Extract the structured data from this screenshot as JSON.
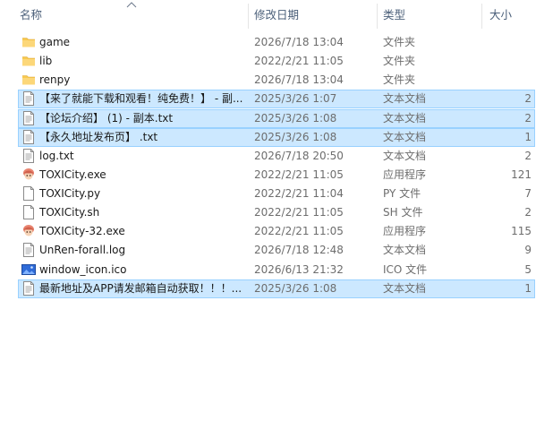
{
  "columns": {
    "name": "名称",
    "date": "修改日期",
    "type": "类型",
    "size": "大小"
  },
  "accent": {
    "selection_bg": "#cce8ff",
    "selection_border": "#99d1ff",
    "folder": "#f8c94f"
  },
  "rows": [
    {
      "name": "game",
      "date": "2026/7/18 13:04",
      "type": "文件夹",
      "size": "",
      "icon": "folder-icon",
      "selected": false
    },
    {
      "name": "lib",
      "date": "2022/2/21 11:05",
      "type": "文件夹",
      "size": "",
      "icon": "folder-icon",
      "selected": false
    },
    {
      "name": "renpy",
      "date": "2026/7/18 13:04",
      "type": "文件夹",
      "size": "",
      "icon": "folder-icon",
      "selected": false
    },
    {
      "name": "【来了就能下载和观看！纯免费！】 - 副...",
      "date": "2025/3/26 1:07",
      "type": "文本文档",
      "size": "2",
      "icon": "text-file-icon",
      "selected": true
    },
    {
      "name": "【论坛介绍】 (1) - 副本.txt",
      "date": "2025/3/26 1:08",
      "type": "文本文档",
      "size": "2",
      "icon": "text-file-icon",
      "selected": true
    },
    {
      "name": "【永久地址发布页】 .txt",
      "date": "2025/3/26 1:08",
      "type": "文本文档",
      "size": "1",
      "icon": "text-file-icon",
      "selected": true
    },
    {
      "name": "log.txt",
      "date": "2026/7/18 20:50",
      "type": "文本文档",
      "size": "2",
      "icon": "text-file-icon",
      "selected": false
    },
    {
      "name": "TOXICity.exe",
      "date": "2022/2/21 11:05",
      "type": "应用程序",
      "size": "121",
      "icon": "app-icon",
      "selected": false
    },
    {
      "name": "TOXICity.py",
      "date": "2022/2/21 11:04",
      "type": "PY 文件",
      "size": "7",
      "icon": "blank-file-icon",
      "selected": false
    },
    {
      "name": "TOXICity.sh",
      "date": "2022/2/21 11:05",
      "type": "SH 文件",
      "size": "2",
      "icon": "blank-file-icon",
      "selected": false
    },
    {
      "name": "TOXICity-32.exe",
      "date": "2022/2/21 11:05",
      "type": "应用程序",
      "size": "115",
      "icon": "app-icon",
      "selected": false
    },
    {
      "name": "UnRen-forall.log",
      "date": "2026/7/18 12:48",
      "type": "文本文档",
      "size": "9",
      "icon": "text-file-icon",
      "selected": false
    },
    {
      "name": "window_icon.ico",
      "date": "2026/6/13 21:32",
      "type": "ICO 文件",
      "size": "5",
      "icon": "image-file-icon",
      "selected": false
    },
    {
      "name": "最新地址及APP请发邮箱自动获取！！！...",
      "date": "2025/3/26 1:08",
      "type": "文本文档",
      "size": "1",
      "icon": "text-file-icon",
      "selected": true
    }
  ]
}
